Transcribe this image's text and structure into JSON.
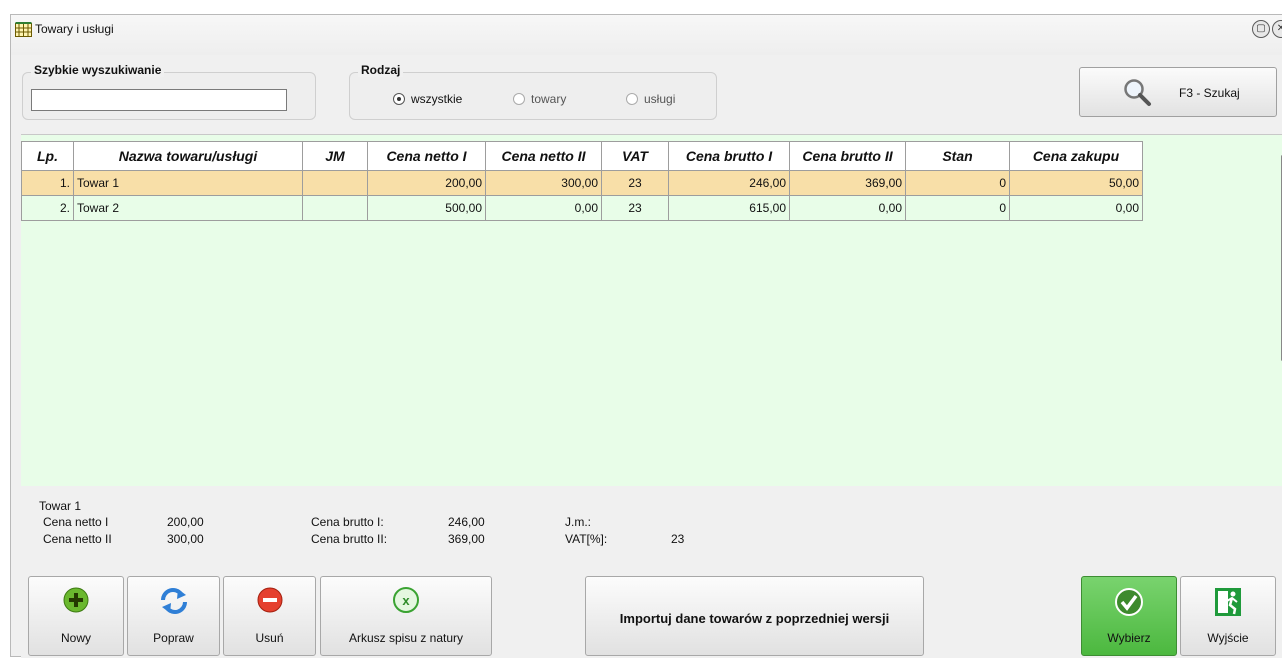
{
  "window": {
    "title": "Towary i usługi"
  },
  "quick_search": {
    "legend": "Szybkie wyszukiwanie",
    "value": ""
  },
  "kind": {
    "legend": "Rodzaj",
    "options": [
      "wszystkie",
      "towary",
      "usługi"
    ],
    "selected": "wszystkie"
  },
  "search_button": {
    "label": "F3 - Szukaj"
  },
  "table": {
    "headers": [
      "Lp.",
      "Nazwa towaru/usługi",
      "JM",
      "Cena netto I",
      "Cena netto II",
      "VAT",
      "Cena brutto I",
      "Cena brutto II",
      "Stan",
      "Cena zakupu"
    ],
    "rows": [
      [
        "1.",
        "Towar 1",
        "",
        "200,00",
        "300,00",
        "23",
        "246,00",
        "369,00",
        "0",
        "50,00"
      ],
      [
        "2.",
        "Towar 2",
        "",
        "500,00",
        "0,00",
        "23",
        "615,00",
        "0,00",
        "0",
        "0,00"
      ]
    ],
    "selected_row": 0
  },
  "details": {
    "name": "Towar 1",
    "netto1_label": "Cena netto I",
    "netto1_value": "200,00",
    "netto2_label": "Cena netto II",
    "netto2_value": "300,00",
    "brutto1_label": "Cena brutto I:",
    "brutto1_value": "246,00",
    "brutto2_label": "Cena brutto II:",
    "brutto2_value": "369,00",
    "jm_label": "J.m.:",
    "jm_value": "",
    "vat_label": "VAT[%]:",
    "vat_value": "23"
  },
  "toolbar": {
    "new": "Nowy",
    "edit": "Popraw",
    "delete": "Usuń",
    "inventory": "Arkusz spisu z natury",
    "import": "Importuj dane towarów z poprzedniej wersji",
    "select": "Wybierz",
    "exit": "Wyjście"
  },
  "colors": {
    "grid_bg": "#e8fde8",
    "selected_row": "#f8dfa8",
    "select_button": "#4cb83f"
  }
}
